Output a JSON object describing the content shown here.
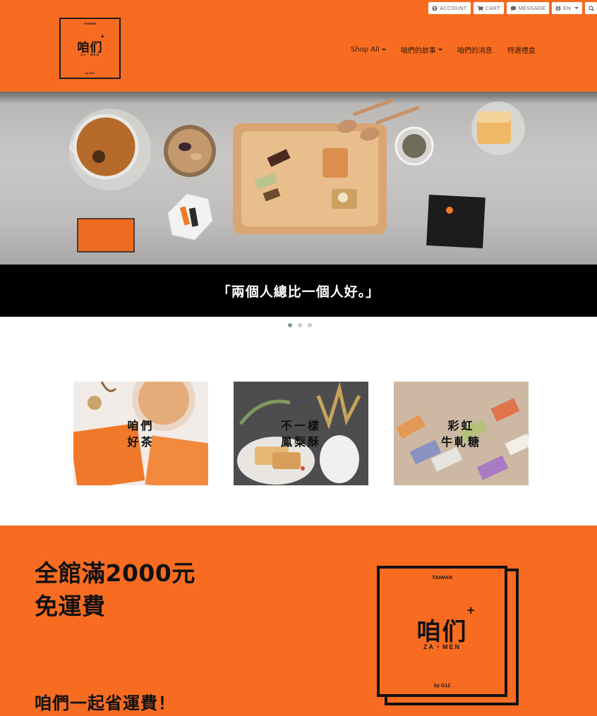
{
  "topbar": {
    "account": "ACCOUNT",
    "cart": "CART",
    "message": "MESSAGE",
    "language": "EN"
  },
  "logo": {
    "top": "TAIWAN",
    "mark": "咱们",
    "sub": "ZA・MEN",
    "by": "by G12"
  },
  "nav": {
    "items": [
      {
        "label": "Shop All",
        "dropdown": true
      },
      {
        "label": "咱們的故事",
        "dropdown": true
      },
      {
        "label": "咱們的消息",
        "dropdown": false
      },
      {
        "label": "特選禮盒",
        "dropdown": false
      }
    ]
  },
  "hero": {
    "caption": "「兩個人總比一個人好。」",
    "slide_count": 3,
    "active_slide": 1
  },
  "categories": [
    {
      "label": "咱們\n好茶"
    },
    {
      "label": "不一樣\n鳳梨酥"
    },
    {
      "label": "彩虹\n牛軋糖"
    }
  ],
  "promo": {
    "title": "全館滿2000元\n免運費",
    "subtitle": "咱們一起省運費！",
    "logo_top": "TAIWAN",
    "logo_mark": "咱们",
    "logo_sub": "ZA・MEN",
    "logo_by": "by G12"
  },
  "colors": {
    "brand_orange": "#f76c21",
    "caption_bar": "#000000",
    "active_dot": "#7d9b96"
  }
}
